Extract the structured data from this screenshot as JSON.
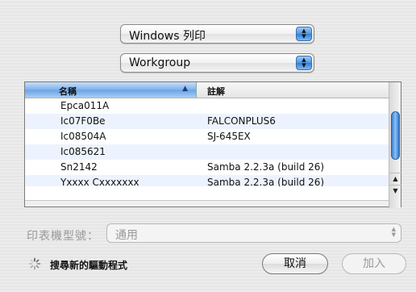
{
  "printer_source_popup": {
    "value": "Windows 列印"
  },
  "workgroup_popup": {
    "value": "Workgroup"
  },
  "printer_table": {
    "columns": {
      "name": "名稱",
      "note": "註解"
    },
    "rows": [
      {
        "name": "Epca011A",
        "note": ""
      },
      {
        "name": "Ic07F0Be",
        "note": "FALCONPLUS6"
      },
      {
        "name": "Ic08504A",
        "note": "SJ-645EX"
      },
      {
        "name": "Ic085621",
        "note": ""
      },
      {
        "name": "Sn2142",
        "note": "Samba 2.2.3a (build 26)"
      },
      {
        "name": "Yxxxx Cxxxxxxx",
        "note": "Samba 2.2.3a (build 26)"
      }
    ]
  },
  "printer_model": {
    "label": "印表機型號：",
    "value": "通用"
  },
  "search_driver": {
    "label": "搜尋新的驅動程式"
  },
  "buttons": {
    "cancel": "取消",
    "add": "加入"
  },
  "colors": {
    "accent": "#4f97e0",
    "alt_row": "#edf3fe"
  }
}
